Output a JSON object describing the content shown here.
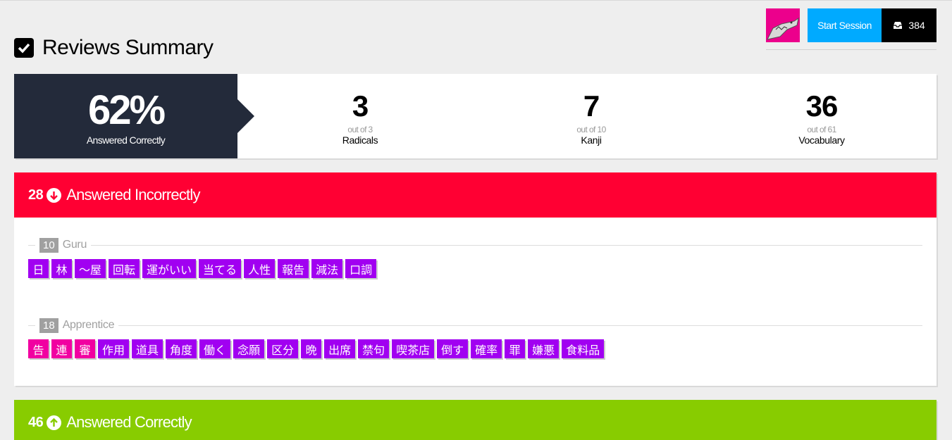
{
  "header": {
    "title": "Reviews Summary",
    "start_session_label": "Start Session",
    "inbox_count": "384"
  },
  "stats": {
    "percent": "62%",
    "percent_label": "Answered Correctly",
    "radicals": {
      "value": "3",
      "out_of": "out of 3",
      "name": "Radicals"
    },
    "kanji": {
      "value": "7",
      "out_of": "out of 10",
      "name": "Kanji"
    },
    "vocabulary": {
      "value": "36",
      "out_of": "out of 61",
      "name": "Vocabulary"
    }
  },
  "incorrect": {
    "count": "28",
    "title": "Answered Incorrectly",
    "color": "#ff0033",
    "groups": [
      {
        "count": "10",
        "name": "Guru",
        "items": [
          {
            "text": "日",
            "type": "vocab"
          },
          {
            "text": "林",
            "type": "vocab"
          },
          {
            "text": "〜屋",
            "type": "vocab"
          },
          {
            "text": "回転",
            "type": "vocab"
          },
          {
            "text": "運がいい",
            "type": "vocab"
          },
          {
            "text": "当てる",
            "type": "vocab"
          },
          {
            "text": "人性",
            "type": "vocab"
          },
          {
            "text": "報告",
            "type": "vocab"
          },
          {
            "text": "減法",
            "type": "vocab"
          },
          {
            "text": "口調",
            "type": "vocab"
          }
        ]
      },
      {
        "count": "18",
        "name": "Apprentice",
        "items": [
          {
            "text": "告",
            "type": "kanji"
          },
          {
            "text": "連",
            "type": "kanji"
          },
          {
            "text": "審",
            "type": "kanji"
          },
          {
            "text": "作用",
            "type": "vocab"
          },
          {
            "text": "道具",
            "type": "vocab"
          },
          {
            "text": "角度",
            "type": "vocab"
          },
          {
            "text": "働く",
            "type": "vocab"
          },
          {
            "text": "念願",
            "type": "vocab"
          },
          {
            "text": "区分",
            "type": "vocab"
          },
          {
            "text": "晩",
            "type": "vocab"
          },
          {
            "text": "出席",
            "type": "vocab"
          },
          {
            "text": "禁句",
            "type": "vocab"
          },
          {
            "text": "喫茶店",
            "type": "vocab"
          },
          {
            "text": "倒す",
            "type": "vocab"
          },
          {
            "text": "確率",
            "type": "vocab"
          },
          {
            "text": "罪",
            "type": "vocab"
          },
          {
            "text": "嫌悪",
            "type": "vocab"
          },
          {
            "text": "食料品",
            "type": "vocab"
          }
        ]
      }
    ]
  },
  "correct": {
    "count": "46",
    "title": "Answered Correctly",
    "color": "#88cc00"
  },
  "colors": {
    "accent": "#00aaff",
    "dark": "#232a3a",
    "kanji": "#f100a1",
    "vocab": "#a100f1"
  }
}
